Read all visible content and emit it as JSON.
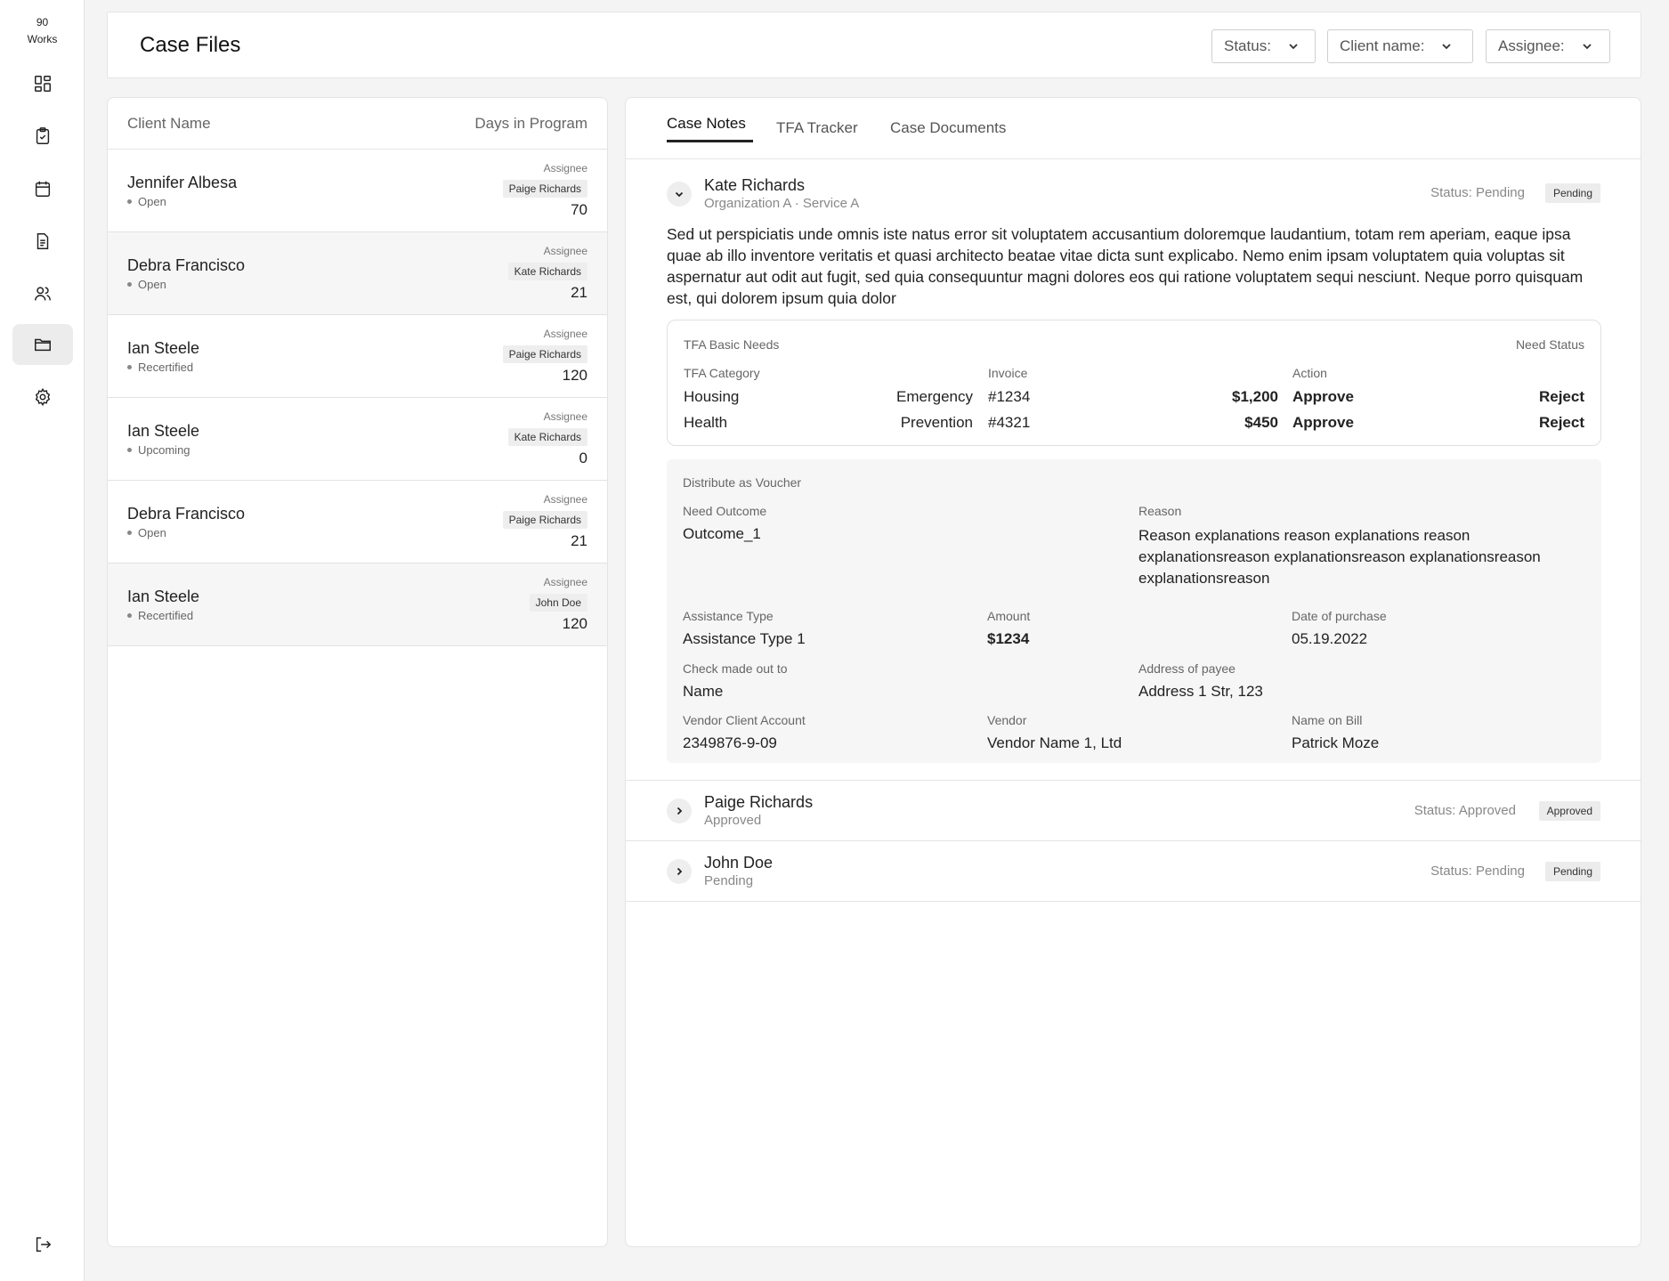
{
  "brand": {
    "line1": "90",
    "line2": "Works"
  },
  "sidebar": {
    "items": [
      {
        "icon": "dashboard-icon"
      },
      {
        "icon": "clipboard-check-icon"
      },
      {
        "icon": "calendar-icon"
      },
      {
        "icon": "document-icon"
      },
      {
        "icon": "users-icon"
      },
      {
        "icon": "folder-icon",
        "active": true
      },
      {
        "icon": "gear-icon"
      }
    ],
    "logout_icon": "logout-icon"
  },
  "header": {
    "title": "Case Files",
    "filters": {
      "status": "Status:",
      "client_name": "Client name:",
      "assignee": "Assignee:"
    }
  },
  "list": {
    "col_client": "Client Name",
    "col_days": "Days in Program",
    "assignee_label": "Assignee",
    "rows": [
      {
        "name": "Jennifer Albesa",
        "status": "Open",
        "assignee": "Paige Richards",
        "days": "70"
      },
      {
        "name": "Debra Francisco",
        "status": "Open",
        "assignee": "Kate Richards",
        "days": "21"
      },
      {
        "name": "Ian Steele",
        "status": "Recertified",
        "assignee": "Paige Richards",
        "days": "120"
      },
      {
        "name": "Ian Steele",
        "status": "Upcoming",
        "assignee": "Kate Richards",
        "days": "0"
      },
      {
        "name": "Debra Francisco",
        "status": "Open",
        "assignee": "Paige Richards",
        "days": "21"
      },
      {
        "name": "Ian Steele",
        "status": "Recertified",
        "assignee": "John Doe",
        "days": "120"
      }
    ]
  },
  "tabs": {
    "case_notes": "Case Notes",
    "tfa_tracker": "TFA Tracker",
    "case_documents": "Case Documents"
  },
  "note1": {
    "name": "Kate Richards",
    "sub": "Organization A · Service A",
    "status_text": "Status: Pending",
    "badge": "Pending",
    "body": "Sed ut perspiciatis unde omnis iste natus error sit voluptatem accusantium doloremque laudantium, totam rem aperiam, eaque ipsa quae ab illo inventore veritatis et quasi architecto beatae vitae dicta sunt explicabo. Nemo enim ipsam voluptatem quia voluptas sit aspernatur aut odit aut fugit, sed quia consequuntur magni dolores eos qui ratione voluptatem sequi nesciunt. Neque porro quisquam est, qui dolorem ipsum quia dolor",
    "needs": {
      "title": "TFA Basic Needs",
      "need_status": "Need Status",
      "col_category": "TFA Category",
      "col_invoice": "Invoice",
      "col_action": "Action",
      "rows": [
        {
          "category": "Housing",
          "type": "Emergency",
          "invoice": "#1234",
          "amount": "$1,200",
          "approve": "Approve",
          "reject": "Reject"
        },
        {
          "category": "Health",
          "type": "Prevention",
          "invoice": "#4321",
          "amount": "$450",
          "approve": "Approve",
          "reject": "Reject"
        }
      ]
    },
    "voucher": {
      "title": "Distribute as Voucher",
      "need_outcome_label": "Need Outcome",
      "need_outcome": "Outcome_1",
      "reason_label": "Reason",
      "reason": "Reason explanations reason explanations reason explanationsreason explanationsreason explanationsreason explanationsreason",
      "assistance_type_label": "Assistance Type",
      "assistance_type": "Assistance Type 1",
      "amount_label": "Amount",
      "amount": "$1234",
      "date_label": "Date of purchase",
      "date": "05.19.2022",
      "check_label": "Check made out to",
      "check": "Name",
      "address_label": "Address of payee",
      "address": "Address 1 Str, 123",
      "vendor_account_label": "Vendor Client Account",
      "vendor_account": "2349876-9-09",
      "vendor_label": "Vendor",
      "vendor": "Vendor Name 1, Ltd",
      "name_on_bill_label": "Name on Bill",
      "name_on_bill": "Patrick Moze"
    }
  },
  "note2": {
    "name": "Paige Richards",
    "sub": "Approved",
    "status_text": "Status: Approved",
    "badge": "Approved"
  },
  "note3": {
    "name": "John Doe",
    "sub": "Pending",
    "status_text": "Status: Pending",
    "badge": "Pending"
  }
}
